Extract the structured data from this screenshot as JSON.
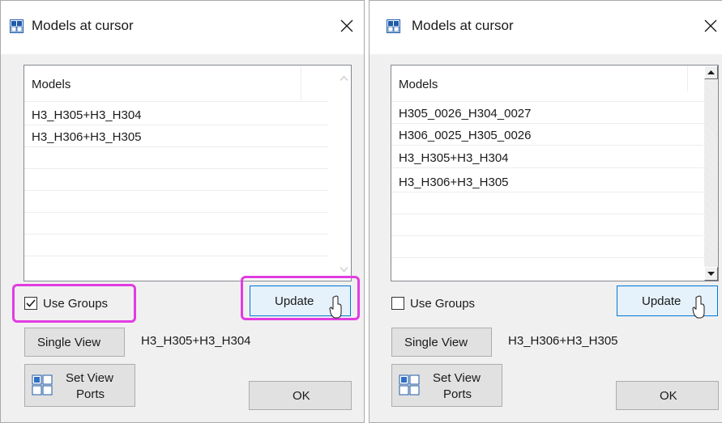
{
  "left_dialog": {
    "title": "Models at cursor",
    "list_header": "Models",
    "models": [
      "H3_H305+H3_H304",
      "H3_H306+H3_H305"
    ],
    "use_groups_label": "Use Groups",
    "use_groups_checked": true,
    "update_label": "Update",
    "single_view_label": "Single View",
    "selected_model": "H3_H305+H3_H304",
    "set_view_ports_line1": "Set View",
    "set_view_ports_line2": "Ports",
    "ok_label": "OK"
  },
  "right_dialog": {
    "title": "Models at cursor",
    "list_header": "Models",
    "models": [
      "H305_0026_H304_0027",
      "H306_0025_H305_0026",
      "H3_H305+H3_H304",
      "H3_H306+H3_H305"
    ],
    "use_groups_label": "Use Groups",
    "use_groups_checked": false,
    "update_label": "Update",
    "single_view_label": "Single View",
    "selected_model": "H3_H306+H3_H305",
    "set_view_ports_line1": "Set View",
    "set_view_ports_line2": "Ports",
    "ok_label": "OK"
  },
  "icons": {
    "app": "window-grid-icon",
    "close": "close-icon",
    "viewports": "viewports-grid-icon",
    "cursor": "mouse-pointer-icon",
    "check": "checkmark-icon"
  },
  "colors": {
    "highlight": "#e23ce2",
    "dialog_bg": "#f0f0f0",
    "button_bg": "#e1e1e1",
    "primary_border": "#0078d7",
    "primary_bg": "#e5f1fb"
  }
}
